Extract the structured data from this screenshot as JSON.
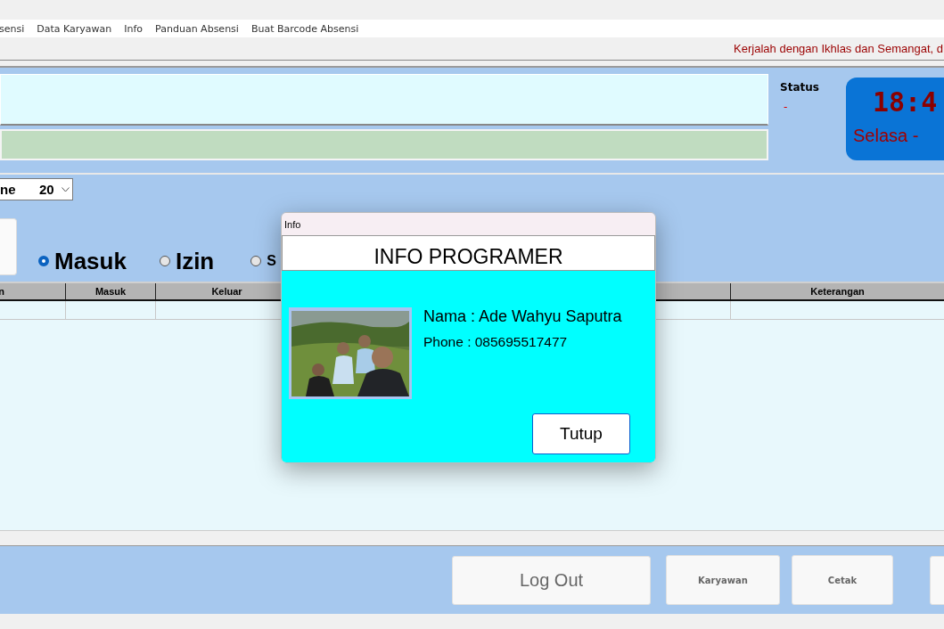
{
  "menu": [
    {
      "label": "sensi"
    },
    {
      "label": "Data Karyawan"
    },
    {
      "label": "Info"
    },
    {
      "label": "Panduan Absensi"
    },
    {
      "label": "Buat Barcode Absensi"
    }
  ],
  "marquee": "Kerjalah dengan Ikhlas dan Semangat, d",
  "status": {
    "label": "Status",
    "value": "-"
  },
  "clock": {
    "time": "18:4",
    "date": "Selasa -"
  },
  "filter": {
    "month": "ne",
    "year": "20"
  },
  "radios": [
    {
      "label": "Masuk",
      "selected": true
    },
    {
      "label": "Izin",
      "selected": false
    },
    {
      "label": "S",
      "selected": false
    }
  ],
  "table": {
    "columns": [
      "n",
      "Masuk",
      "Keluar",
      "Keterangan"
    ]
  },
  "buttons": [
    {
      "label": "Log Out",
      "kind": "large"
    },
    {
      "label": "Karyawan",
      "kind": "small"
    },
    {
      "label": "Cetak",
      "kind": "small"
    }
  ],
  "dialog": {
    "title": "Info",
    "heading": "INFO PROGRAMER",
    "name": "Nama : Ade Wahyu Saputra",
    "phone": "Phone : 085695517477",
    "close_button": "Tutup"
  }
}
